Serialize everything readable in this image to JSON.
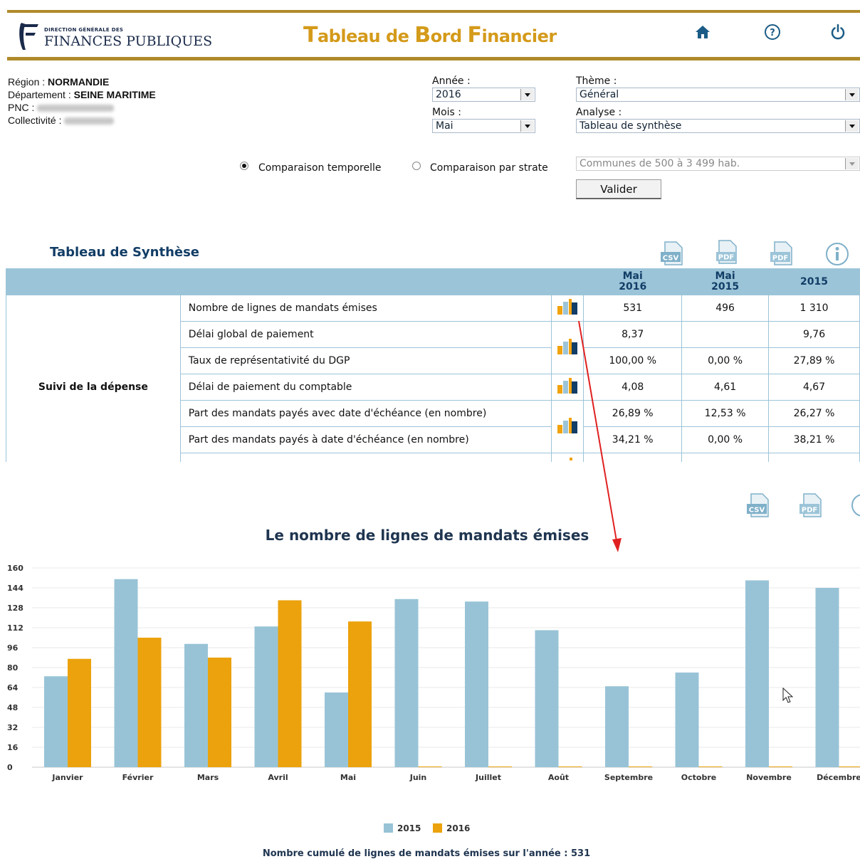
{
  "header": {
    "logo_small": "DIRECTION GÉNÉRALE DES",
    "logo_big": "FINANCES PUBLIQUES",
    "app_title_parts": [
      {
        "cap": "T",
        "rest": "ableau de "
      },
      {
        "cap": "B",
        "rest": "ord "
      },
      {
        "cap": "F",
        "rest": "inancier"
      }
    ],
    "icons": [
      "home-icon",
      "help-icon",
      "power-icon"
    ]
  },
  "info": {
    "region_label": "Région :",
    "region_value": "NORMANDIE",
    "departement_label": "Département :",
    "departement_value": "SEINE MARITIME",
    "pnc_label": "PNC :",
    "collectivite_label": "Collectivité :"
  },
  "filters": {
    "annee_label": "Année :",
    "annee_value": "2016",
    "mois_label": "Mois :",
    "mois_value": "Mai",
    "theme_label": "Thème :",
    "theme_value": "Général",
    "analyse_label": "Analyse :",
    "analyse_value": "Tableau de synthèse",
    "strate_value": "Communes de 500 à 3 499 hab.",
    "radio_temporelle": "Comparaison temporelle",
    "radio_strate": "Comparaison par strate",
    "selected_radio": "temporelle",
    "valider": "Valider"
  },
  "synthese": {
    "title": "Tableau de Synthèse",
    "export_icons": [
      "csv-icon",
      "pdf-icon",
      "pdf-icon",
      "info-icon"
    ],
    "columns": [
      {
        "l1": "Mai",
        "l2": "2016"
      },
      {
        "l1": "Mai",
        "l2": "2015"
      },
      {
        "l1": "2015",
        "l2": ""
      }
    ],
    "group": "Suivi de la dépense",
    "rows": [
      {
        "label": "Nombre de lignes de mandats émises",
        "v": [
          "531",
          "496",
          "1 310"
        ]
      },
      {
        "label": "Délai global de paiement",
        "v": [
          "8,37",
          "",
          "9,76"
        ]
      },
      {
        "label": "Taux de représentativité du DGP",
        "v": [
          "100,00 %",
          "0,00 %",
          "27,89 %"
        ]
      },
      {
        "label": "Délai de paiement du comptable",
        "v": [
          "4,08",
          "4,61",
          "4,67"
        ]
      },
      {
        "label": "Part des mandats payés avec date d'échéance (en nombre)",
        "v": [
          "26,89 %",
          "12,53 %",
          "26,27 %"
        ]
      },
      {
        "label": "Part des mandats payés à date d'échéance (en nombre)",
        "v": [
          "34,21 %",
          "0,00 %",
          "38,21 %"
        ]
      }
    ]
  },
  "chart_export_icons": [
    "csv-icon",
    "pdf-icon",
    "info-icon"
  ],
  "annotation_arrow_color": "#e02020",
  "colors": {
    "s2015": "#98c3d6",
    "s2016": "#eba20c",
    "header_gold": "#b08a2a",
    "title_gold": "#d49a1a",
    "navy": "#123d66"
  },
  "chart_data": {
    "type": "bar",
    "title": "Le nombre de lignes de mandats émises",
    "categories": [
      "Janvier",
      "Février",
      "Mars",
      "Avril",
      "Mai",
      "Juin",
      "Juillet",
      "Août",
      "Septembre",
      "Octobre",
      "Novembre",
      "Décembre"
    ],
    "series": [
      {
        "name": "2015",
        "color": "#98c3d6",
        "values": [
          73,
          151,
          99,
          113,
          60,
          135,
          133,
          110,
          65,
          76,
          150,
          144
        ]
      },
      {
        "name": "2016",
        "color": "#eba20c",
        "values": [
          87,
          104,
          88,
          134,
          117,
          0,
          0,
          0,
          0,
          0,
          0,
          0
        ]
      }
    ],
    "yticks": [
      "0",
      "16",
      "32",
      "48",
      "64",
      "80",
      "96",
      "112",
      "128",
      "144",
      "160"
    ],
    "ylim": [
      0,
      160
    ],
    "grid": true,
    "legend": "bottom-center",
    "footer": "Nombre cumulé de lignes de mandats émises sur l'année : 531"
  }
}
